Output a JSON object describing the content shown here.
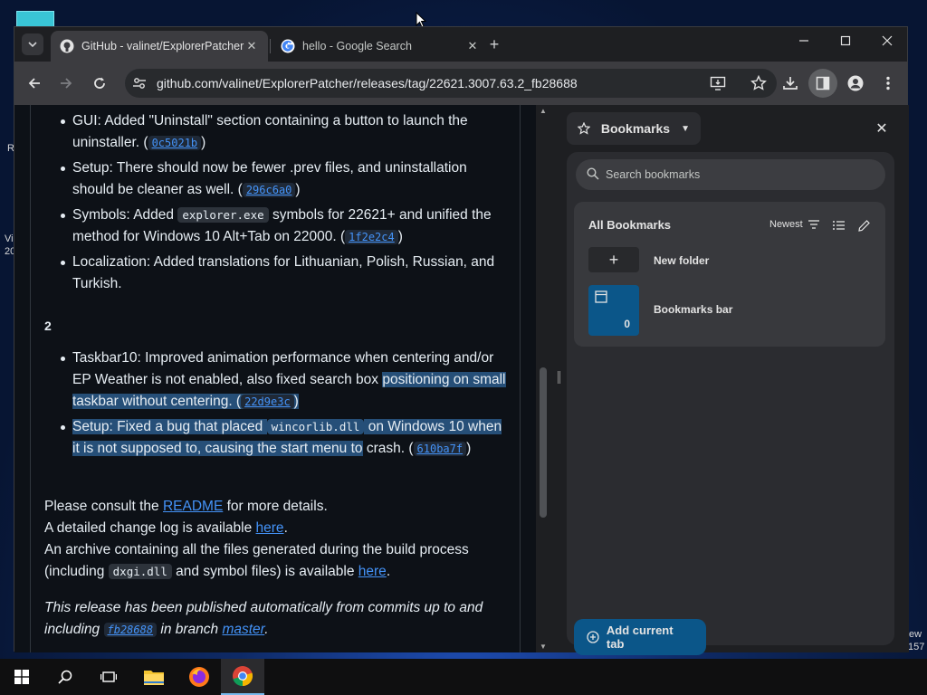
{
  "desktop": {
    "left_text_1": "R",
    "left_text_2": "Vi",
    "left_text_3": "20",
    "right_text_1": "ew",
    "right_text_2": "157"
  },
  "browser": {
    "tabs": [
      {
        "label": "GitHub - valinet/ExplorerPatcher",
        "active": true
      },
      {
        "label": "hello - Google Search",
        "active": false
      }
    ],
    "url": "github.com/valinet/ExplorerPatcher/releases/tag/22621.3007.63.2_fb28688"
  },
  "content": {
    "list1": [
      {
        "text": "GUI: Added \"Uninstall\" section containing a button to launch the uninstaller. (",
        "commit": "0c5021b",
        "after": ")"
      },
      {
        "text": "Setup: There should now be fewer .prev files, and uninstallation should be cleaner as well. (",
        "commit": "296c6a0",
        "after": ")"
      },
      {
        "pre": "Symbols: Added ",
        "code": "explorer.exe",
        "text": " symbols for 22621+ and unified the method for Windows 10 Alt+Tab on 22000. (",
        "commit": "1f2e2c4",
        "after": ")"
      },
      {
        "text": "Localization: Added translations for Lithuanian, Polish, Russian, and Turkish."
      }
    ],
    "heading": "2",
    "list2": [
      {
        "text_a": "Taskbar10: Improved animation performance when centering and/or EP Weather is not enabled, also fixed search box ",
        "text_b": "positioning on small taskbar without centering. (",
        "commit": "22d9e3c",
        "after": ")"
      },
      {
        "pre": "Setup: Fixed a bug that placed ",
        "code": "wincorlib.dll",
        "text_a": " on Windows 10 when it is not supposed to, causing the start menu to",
        "text_b": " crash.",
        "commit": "610ba7f",
        "after": ")"
      }
    ],
    "consult_pre": "Please consult the ",
    "consult_link": "README",
    "consult_post": " for more details.",
    "changelog_pre": "A detailed change log is available ",
    "changelog_link": "here",
    "changelog_post": ".",
    "archive_text": "An archive containing all the files generated during the build process (including ",
    "archive_code": "dxgi.dll",
    "archive_post": " and symbol files) is available ",
    "archive_link": "here",
    "archive_end": ".",
    "footer_pre": "This release has been published automatically from commits up to and including ",
    "footer_commit": "fb28688",
    "footer_mid": " in branch ",
    "footer_link": "master",
    "footer_end": "."
  },
  "bookmarks": {
    "title": "Bookmarks",
    "search_placeholder": "Search bookmarks",
    "all_label": "All Bookmarks",
    "sort_label": "Newest",
    "new_folder_label": "New folder",
    "folder_name": "Bookmarks bar",
    "folder_count": "0",
    "add_tab_label": "Add current tab"
  },
  "colors": {
    "accent": "#0b5689",
    "link": "#4493f8",
    "selection": "#264f78"
  }
}
